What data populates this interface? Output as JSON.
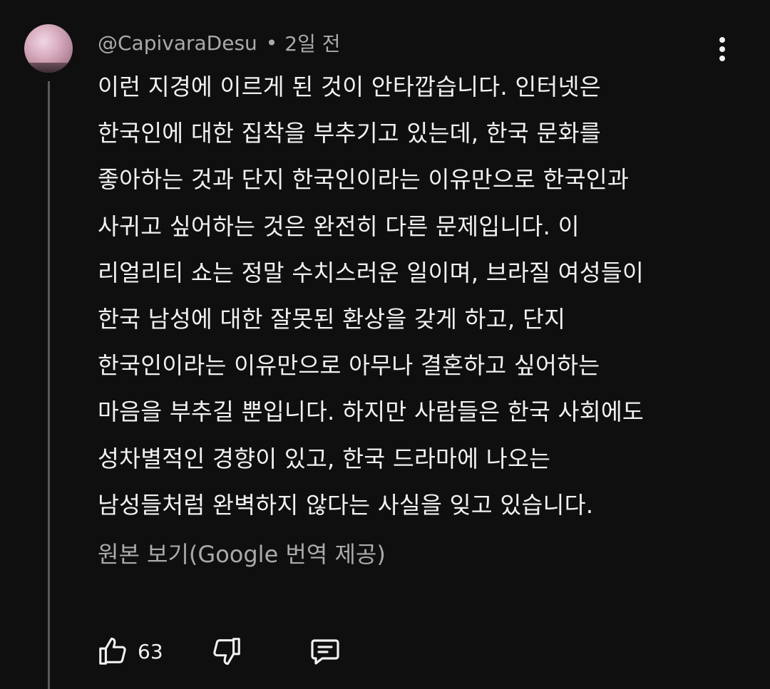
{
  "comment": {
    "author": "@CapivaraDesu",
    "separator": "•",
    "time": "2일 전",
    "lines": [
      "이런 지경에 이르게 된 것이 안타깝습니다. 인터넷은",
      "한국인에 대한 집착을 부추기고 있는데, 한국 문화를",
      "좋아하는 것과 단지 한국인이라는 이유만으로 한국인과",
      "사귀고 싶어하는 것은 완전히 다른 문제입니다. 이",
      "리얼리티 쇼는 정말 수치스러운 일이며, 브라질 여성들이",
      "한국 남성에 대한 잘못된 환상을 갖게 하고, 단지",
      "한국인이라는 이유만으로 아무나 결혼하고 싶어하는",
      "마음을 부추길 뿐입니다. 하지만 사람들은 한국 사회에도",
      "성차별적인 경향이 있고, 한국 드라마에 나오는",
      "남성들처럼 완벽하지 않다는 사실을 잊고 있습니다."
    ],
    "see_original": "원본 보기(Google 번역 제공)",
    "like_count": "63"
  },
  "icons": {
    "menu": "more-vert-icon",
    "like": "thumb-up-icon",
    "dislike": "thumb-down-icon",
    "reply": "comment-reply-icon"
  },
  "colors": {
    "background": "#0f0f0f",
    "text_primary": "#f1f1f1",
    "text_secondary": "#aaaaaa",
    "thread_line": "#5a5a5a"
  }
}
